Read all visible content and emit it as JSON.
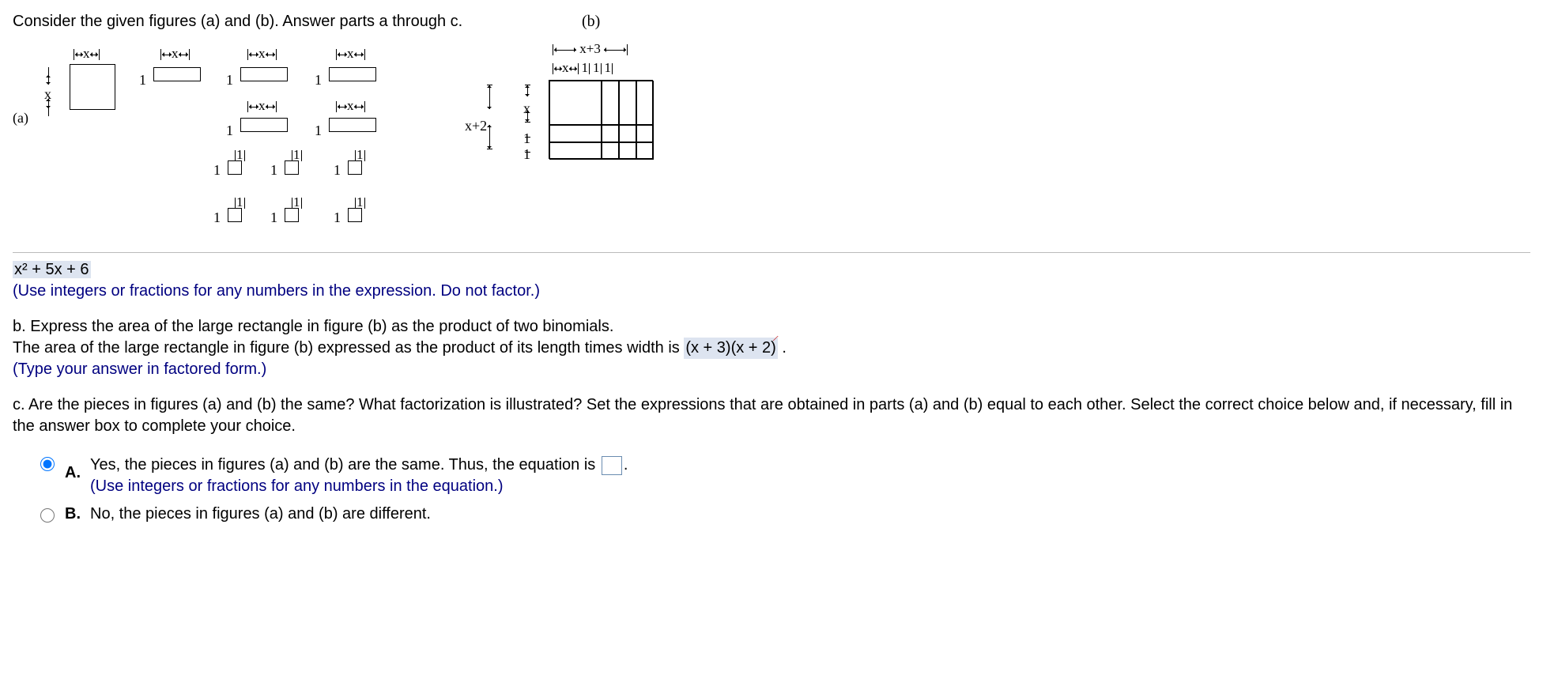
{
  "intro": "Consider the given figures (a) and (b). Answer parts a through c.",
  "fig_a_label": "(a)",
  "fig_b_label": "(b)",
  "dim_x": "x",
  "dim_one": "1",
  "dim_xp3": "x+3",
  "dim_xp2": "x+2",
  "answer_a": "x² + 5x + 6",
  "hint_a": "(Use integers or fractions for any numbers in the expression. Do not factor.)",
  "part_b_q": "b. Express the area of the large rectangle in figure (b) as the product of two binomials.",
  "part_b_stmt_pre": "The area of the large rectangle in figure (b) expressed as the product of its length times width is  ",
  "answer_b": "(x + 3)(x + 2)",
  "part_b_stmt_post": " .",
  "hint_b": "(Type your answer in factored form.)",
  "part_c_q": "c. Are the pieces in figures (a) and (b) the same? What factorization is illustrated? Set the expressions that are obtained in parts (a) and (b) equal to each other. Select the correct choice below and, if necessary, fill in the answer box to complete your choice.",
  "choice_A_letter": "A.",
  "choice_A_text_pre": "Yes, the pieces in figures (a) and (b) are the same. Thus, the equation is ",
  "choice_A_text_post": ".",
  "choice_A_hint": " (Use integers or fractions for any numbers in the equation.)",
  "choice_B_letter": "B.",
  "choice_B_text": "No, the pieces in figures (a) and (b) are different.",
  "selected_choice": "A"
}
